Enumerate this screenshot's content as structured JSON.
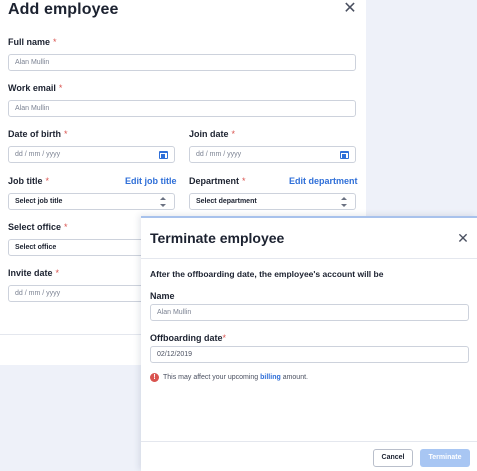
{
  "add_employee": {
    "title": "Add employee",
    "close_glyph": "✕",
    "full_name": {
      "label": "Full name",
      "value": "Alan Mullin"
    },
    "work_email": {
      "label": "Work email",
      "value": "Alan Mullin"
    },
    "date_of_birth": {
      "label": "Date of birth",
      "placeholder": "dd / mm / yyyy"
    },
    "join_date": {
      "label": "Join date",
      "placeholder": "dd / mm / yyyy"
    },
    "job_title": {
      "label": "Job title",
      "edit_link": "Edit job title",
      "value": "Select job title"
    },
    "department": {
      "label": "Department",
      "edit_link": "Edit department",
      "value": "Select department"
    },
    "select_office": {
      "label": "Select office",
      "value": "Select office"
    },
    "invite_date": {
      "label": "Invite date",
      "placeholder": "dd / mm / yyyy"
    },
    "required_mark": "*"
  },
  "terminate_modal": {
    "title": "Terminate employee",
    "close_glyph": "✕",
    "description": "After the offboarding date, the employee's account will be",
    "name_label": "Name",
    "name_value": "Alan Mullin",
    "offboarding_label": "Offboarding date",
    "offboarding_value": "02/12/2019",
    "required_mark": "*",
    "warning_icon": "!",
    "warning_prefix": "This may affect your upcoming ",
    "warning_link": "billing",
    "warning_suffix": " amount.",
    "cancel_label": "Cancel",
    "terminate_label": "Terminate"
  },
  "colors": {
    "accent": "#2f6fd8",
    "required": "#d9534f",
    "terminate_disabled": "#a8c6f3",
    "backdrop": "#eef1f9"
  },
  "icons": {
    "close": "close-icon",
    "calendar": "calendar-icon",
    "select": "updown-arrows-icon",
    "warning": "error-circle-icon"
  }
}
